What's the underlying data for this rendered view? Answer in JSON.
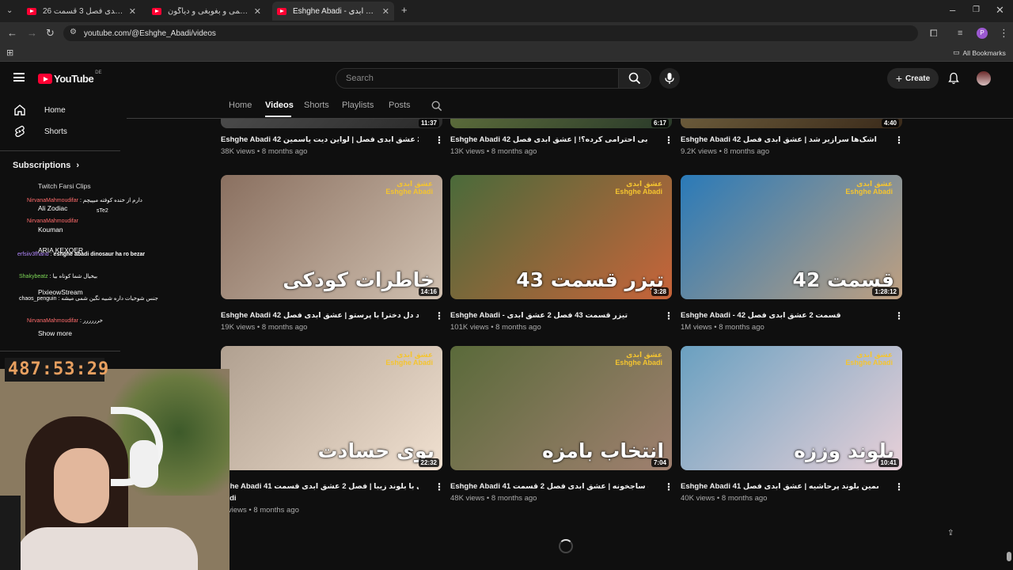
{
  "browser": {
    "tabs": [
      {
        "title": "عشق ابدی فصل 3 قسمت 26 - Yo...",
        "active": false
      },
      {
        "title": "عاشق عزیمی و بغوبغی و دیاگون",
        "active": false
      },
      {
        "title": "Eshghe Abadi - عشق ابدی - YouTube",
        "active": true
      }
    ],
    "url": "youtube.com/@Eshghe_Abadi/videos",
    "bookmarks_label": "All Bookmarks"
  },
  "youtube": {
    "logo_text": "YouTube",
    "region": "DE",
    "search_placeholder": "Search",
    "create_label": "Create",
    "channel_tabs": [
      "Home",
      "Videos",
      "Shorts",
      "Playlists",
      "Posts"
    ],
    "sidebar": {
      "items": [
        "Home",
        "Shorts"
      ],
      "subscriptions_title": "Subscriptions",
      "show_more": "Show more"
    }
  },
  "videos": [
    {
      "title": "Eshghe Abadi 42 قسمت 2 عشق ابدی فصل | لواین دیت یاسمین",
      "meta": "38K views • 8 months ago",
      "duration": "11:37",
      "overlay": ""
    },
    {
      "title": "Eshghe Abadi 42 قسمت 2 کی بی احترامی کرده؟! | عشق ابدی فصل",
      "meta": "13K views • 8 months ago",
      "duration": "6:17",
      "overlay": ""
    },
    {
      "title": "Eshghe Abadi 42 قسمت 2 اشک‌ها سرازیر شد | عشق ابدی فصل",
      "meta": "9.2K views • 8 months ago",
      "duration": "4:40",
      "overlay": ""
    },
    {
      "title": "Eshghe Abadi 42 قسمت 2 درد دل دخترا با پرستو | عشق ابدی فصل",
      "meta": "19K views • 8 months ago",
      "duration": "14:16",
      "overlay": "خاطرات کودکی"
    },
    {
      "title": "Eshghe Abadi - تیزر قسمت 43 فصل 2 عشق ابدی",
      "meta": "101K views • 8 months ago",
      "duration": "3:28",
      "overlay": "تیزر قسمت 43"
    },
    {
      "title": "Eshghe Abadi - 42 قسمت 2 عشق ابدی فصل",
      "meta": "1M views • 8 months ago",
      "duration": "1:28:12",
      "overlay": "قسمت 42"
    },
    {
      "title": "hghe Abadi 41 لحظه آشنایی با بلوند زیبا | فصل 2 عشق ابدی قسمت",
      "title2": "badi",
      "meta": "K views • 8 months ago",
      "duration": "22:32",
      "overlay": "بوی حسادت"
    },
    {
      "title": "Eshghe Abadi 41 انتخاب ساجخونه | عشق ابدی فصل 2 قسمت",
      "meta": "48K views • 8 months ago",
      "duration": "7:04",
      "overlay": "انتخاب بامزه"
    },
    {
      "title": "Eshghe Abadi 41 قسمت 2 یاسمین بلوند پرحاشیه | عشق ابدی فصل",
      "meta": "40K views • 8 months ago",
      "duration": "10:41",
      "overlay": "بلوند وززه"
    }
  ],
  "thumb_logo": "عشق ابدی\nEshghe Abadi",
  "stream": {
    "timer": "487:53:29",
    "chat": [
      {
        "user": "NirvanaMahmoudifar",
        "msg": "دارم از خنده کوفته میپیچم",
        "color": "#ff6b6b"
      },
      {
        "user": "Ali Zodiac",
        "msg": "",
        "color": "#ffffff"
      },
      {
        "user": "Kouman",
        "msg": "",
        "color": "#ffffff"
      },
      {
        "user": "erfsiiv3fhand",
        "msg": "eshghe abadi dinosaur ha ro bezar",
        "color": "#b388ff"
      },
      {
        "user": "ARIA KEXOER",
        "msg": "",
        "color": "#ffffff"
      },
      {
        "user": "Shakybeatz",
        "msg": "بیخیال شما کوتاه بیا",
        "color": "#7ed957"
      },
      {
        "user": "chaos_penguin",
        "msg": "جنس شوخیات داره شبیه نگین شمی میشه",
        "color": "#ffffff"
      },
      {
        "user": "PixieowStream",
        "msg": "",
        "color": "#ffffff"
      },
      {
        "user": "NirvanaMahmoudifar",
        "msg": "خرررررر",
        "color": "#ff6b6b"
      }
    ],
    "labels": {
      "twitch": "Twitch Farsi Clips",
      "stex": "sTe2"
    }
  }
}
